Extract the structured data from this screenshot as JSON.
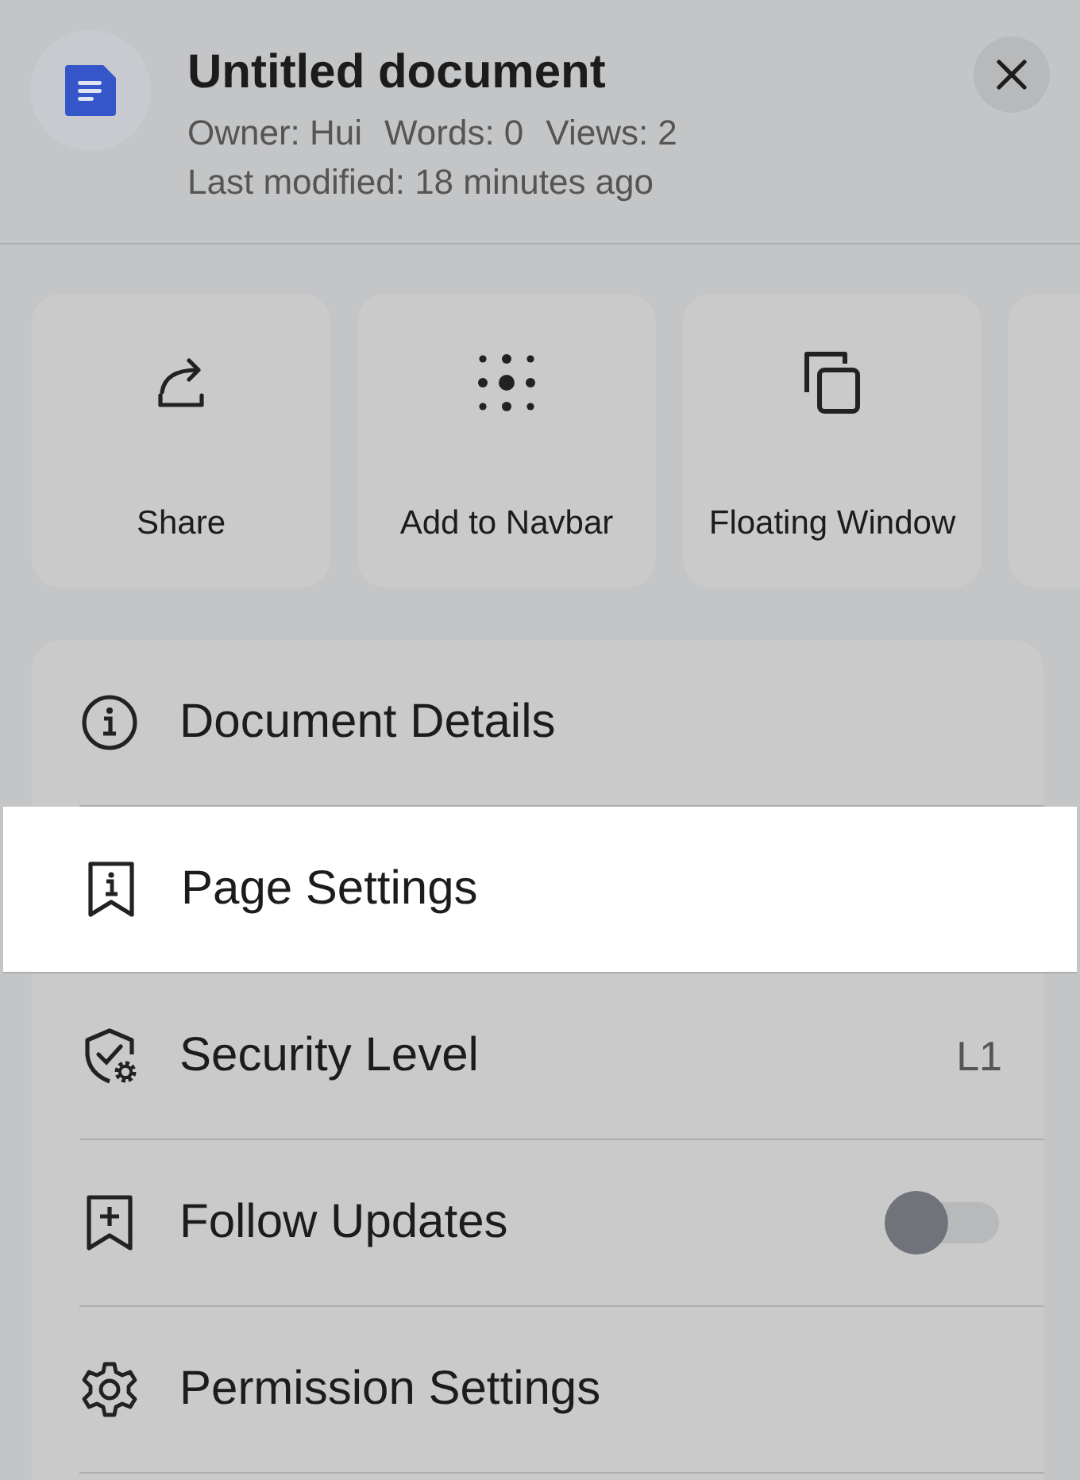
{
  "header": {
    "title": "Untitled document",
    "meta": [
      "Owner: Hui",
      "Words: 0",
      "Views: 2"
    ],
    "modified": "Last modified: 18 minutes ago"
  },
  "actions": [
    {
      "kind": "share",
      "label": "Share"
    },
    {
      "kind": "navbar",
      "label": "Add to Navbar"
    },
    {
      "kind": "floating",
      "label": "Floating Window"
    }
  ],
  "menu": [
    {
      "kind": "info",
      "label": "Document Details",
      "selected": false
    },
    {
      "kind": "page",
      "label": "Page Settings",
      "selected": true
    },
    {
      "kind": "security",
      "label": "Security Level",
      "value": "L1",
      "selected": false
    },
    {
      "kind": "follow",
      "label": "Follow Updates",
      "toggle": false,
      "selected": false
    },
    {
      "kind": "permission",
      "label": "Permission Settings",
      "selected": false
    }
  ]
}
